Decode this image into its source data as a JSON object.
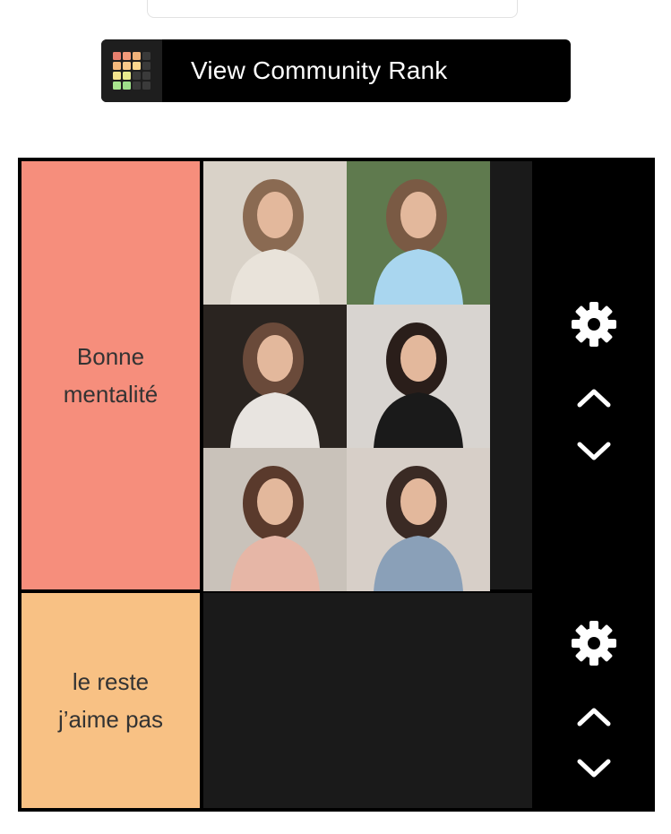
{
  "rank_button": {
    "label": "View Community Rank",
    "icon": "grid-icon",
    "grid_colors": [
      [
        "#e8806e",
        "#f29a7a",
        "#f0b27a",
        "#3a3a3a"
      ],
      [
        "#f6b97c",
        "#f9c98a",
        "#fbd78e",
        "#3a3a3a"
      ],
      [
        "#f4e48e",
        "#e9ea8e",
        "#3a3a3a",
        "#3a3a3a"
      ],
      [
        "#a8e68e",
        "#9ee08a",
        "#3a3a3a",
        "#3a3a3a"
      ]
    ]
  },
  "tiers": [
    {
      "label": "Bonne\nmentalité",
      "color": "#f68e7c",
      "items": [
        {
          "name": "photo-woman-blonde-drink",
          "bg": "#d9d2c8",
          "figure": "#8a6a52",
          "shirt": "#e9e3da"
        },
        {
          "name": "photo-man-light-blue-suit",
          "bg": "#5f7a4e",
          "figure": "#7a5a44",
          "shirt": "#a9d6ef"
        },
        {
          "name": "photo-woman-car-selfie",
          "bg": "#2a2420",
          "figure": "#6a4a3a",
          "shirt": "#e8e4e0"
        },
        {
          "name": "photo-woman-curly-hair",
          "bg": "#d8d4d0",
          "figure": "#2a1e1a",
          "shirt": "#1a1a1a"
        },
        {
          "name": "photo-woman-honey-shirt",
          "bg": "#c9c2ba",
          "figure": "#5a3a2c",
          "shirt": "#e6b6a6"
        },
        {
          "name": "photo-woman-mirror-jeans",
          "bg": "#d7cfc8",
          "figure": "#3a2a24",
          "shirt": "#8aa0b8"
        }
      ]
    },
    {
      "label": "le reste\nj’aime pas",
      "color": "#f8c184",
      "items": []
    }
  ],
  "controls": {
    "settings_icon": "gear-icon",
    "up_icon": "chevron-up-icon",
    "down_icon": "chevron-down-icon"
  }
}
